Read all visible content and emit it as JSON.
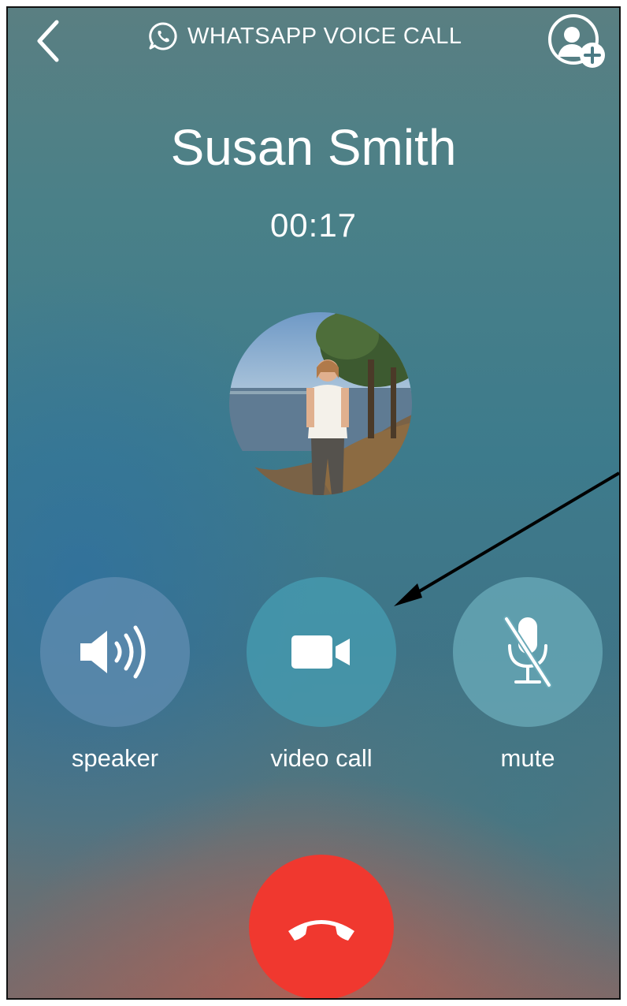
{
  "header": {
    "back_icon": "chevron-left-icon",
    "call_type_icon": "whatsapp-icon",
    "call_type_label": "WHATSAPP VOICE CALL",
    "add_icon": "add-participant-icon"
  },
  "contact": {
    "name": "Susan Smith",
    "duration": "00:17"
  },
  "controls": [
    {
      "label": "speaker",
      "icon": "speaker-icon"
    },
    {
      "label": "video call",
      "icon": "video-camera-icon"
    },
    {
      "label": "mute",
      "icon": "microphone-off-icon"
    }
  ],
  "end_call": {
    "icon": "phone-hangup-icon",
    "color": "#f0382f"
  }
}
